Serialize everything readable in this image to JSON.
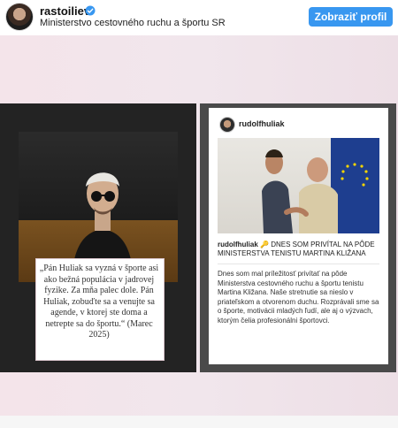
{
  "header": {
    "username": "rastoiliev",
    "subtitle": "Ministerstvo cestovného ruchu a športu SR",
    "profile_button": "Zobraziť profil"
  },
  "left_panel": {
    "quote": "„Pán Huliak sa vyzná v športe asi ako bežná populácia v jadrovej fyzike. Za mňa palec dole. Pán Huliak, zobuďte sa a venujte sa agende, v ktorej ste doma a netrepte sa do športu.“ (Marec 2025)"
  },
  "right_panel": {
    "username": "rudolfhuliak",
    "caption_user": "rudolfhuliak",
    "caption_title": "🔑 DNES SOM PRIVÍTAL NA PÔDE MINISTERSTVA TENISTU MARTINA KLIŽANA",
    "caption_body": "Dnes som mal príležitosť privítať na pôde Ministerstva cestovného ruchu a športu tenistu Martina Kližana. Naše stretnutie sa nieslo v priateľskom a otvorenom duchu. Rozprávali sme sa o športe, motivácii mladých ľudí, ale aj o výzvach, ktorým čelia profesionálni športovci."
  }
}
